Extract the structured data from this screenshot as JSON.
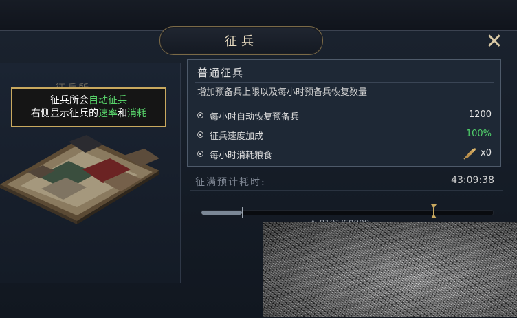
{
  "window": {
    "title": "征兵",
    "close": "✕"
  },
  "building": {
    "name": "征兵所"
  },
  "tip": {
    "line1_prefix": "征兵所会",
    "line1_highlight": "自动征兵",
    "line2_prefix": "右侧显示征兵的",
    "line2_hl1": "速率",
    "line2_mid": "和",
    "line2_hl2": "消耗"
  },
  "card": {
    "title": "普通征兵",
    "description": "增加预备兵上限以及每小时预备兵恢复数量",
    "rows": [
      {
        "label": "每小时自动恢复预备兵",
        "value": "1200"
      },
      {
        "label": "征兵速度加成",
        "value": "100%"
      },
      {
        "label": "每小时消耗粮食",
        "value": "x0",
        "icon": "wheat-icon"
      }
    ]
  },
  "time": {
    "label": "征满预计耗时:",
    "value": "43:09:38"
  },
  "reserve": {
    "count": "8191/60000",
    "fill_fraction": 0.1365
  },
  "colors": {
    "accent_gold": "#c9a95f",
    "highlight_green": "#58d36a"
  }
}
